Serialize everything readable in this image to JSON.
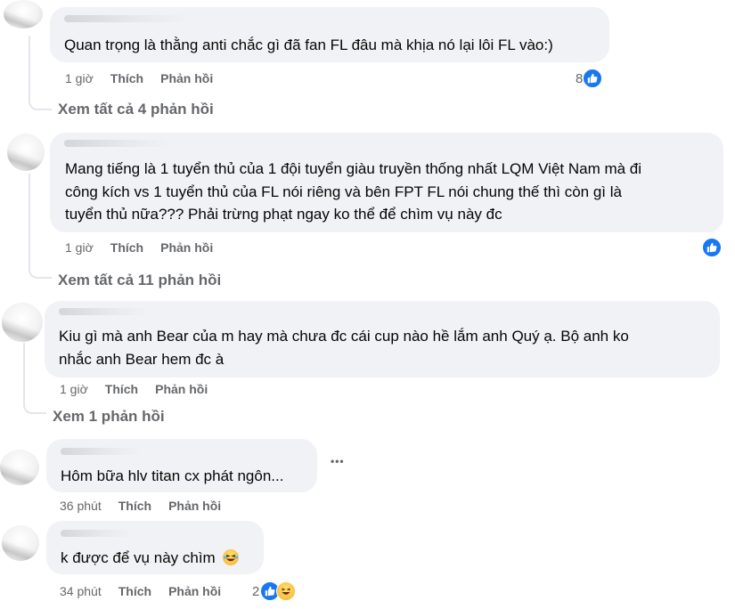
{
  "comments": [
    {
      "text_lines": [
        "Quan trọng là thằng anti chắc gì đã fan FL đâu mà khịa nó lại lôi FL vào:)"
      ],
      "time": "1 giờ",
      "like_label": "Thích",
      "reply_label": "Phản hồi",
      "reaction_count": "8",
      "reactions": [
        "like-icon"
      ],
      "view_replies": "Xem tất cả 4 phản hồi"
    },
    {
      "text_lines": [
        "Mang tiếng là 1 tuyển thủ của 1 đội tuyển giàu truyền thống nhất LQM Việt Nam mà đi",
        "công kích vs 1 tuyển thủ của FL nói riêng và bên FPT FL nói chung thế thì còn gì là",
        "tuyển thủ nữa??? Phải trừng phạt ngay ko thể để chìm vụ này đc"
      ],
      "time": "1 giờ",
      "like_label": "Thích",
      "reply_label": "Phản hồi",
      "reaction_count": "",
      "reactions": [
        "like-icon"
      ],
      "view_replies": "Xem tất cả 11 phản hồi"
    },
    {
      "text_lines": [
        "Kiu gì mà anh Bear của m hay mà chưa đc cái cup nào hề lắm anh Quý ạ. Bộ anh ko",
        "nhắc anh Bear hem đc à"
      ],
      "time": "1 giờ",
      "like_label": "Thích",
      "reply_label": "Phản hồi",
      "view_replies": "Xem 1 phản hồi"
    },
    {
      "text_lines": [
        "Hôm bữa hlv titan cx phát ngôn..."
      ],
      "time": "36 phút",
      "like_label": "Thích",
      "reply_label": "Phản hồi",
      "more_label": "•••"
    },
    {
      "text_lines": [
        "k được để vụ này chìm"
      ],
      "time": "34 phút",
      "like_label": "Thích",
      "reply_label": "Phản hồi",
      "reaction_count": "2",
      "reactions": [
        "like-icon",
        "haha-icon"
      ]
    }
  ],
  "colors": {
    "bubble_bg": "#f0f2f5",
    "meta_text": "#65676b",
    "like_blue": "#1877f2"
  }
}
